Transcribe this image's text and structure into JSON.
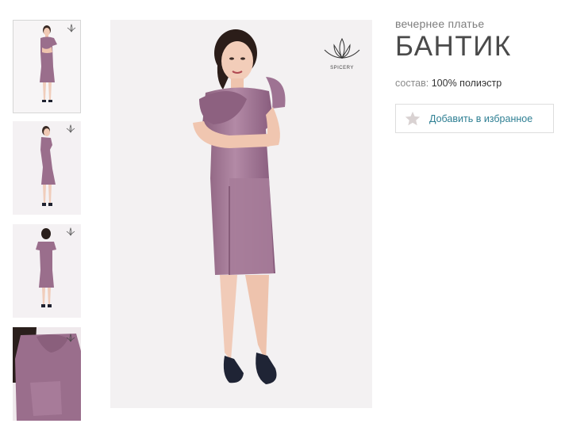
{
  "product": {
    "subtitle": "вечернее платье",
    "title": "БАНТИК",
    "composition_label": "состав:",
    "composition_value": "100% полиэстр"
  },
  "favorite_button": {
    "label": "Добавить в избранное",
    "icon": "star-icon"
  },
  "brand": {
    "name": "SPICERY",
    "logo_icon": "lotus-icon"
  },
  "thumbnails": [
    {
      "name": "front view",
      "active": true
    },
    {
      "name": "side view",
      "active": false
    },
    {
      "name": "back view",
      "active": false
    },
    {
      "name": "detail view",
      "active": false
    }
  ],
  "colors": {
    "dress": "#9a6e8c",
    "accent_link": "#2e7f93",
    "star": "#d9d2d2"
  }
}
